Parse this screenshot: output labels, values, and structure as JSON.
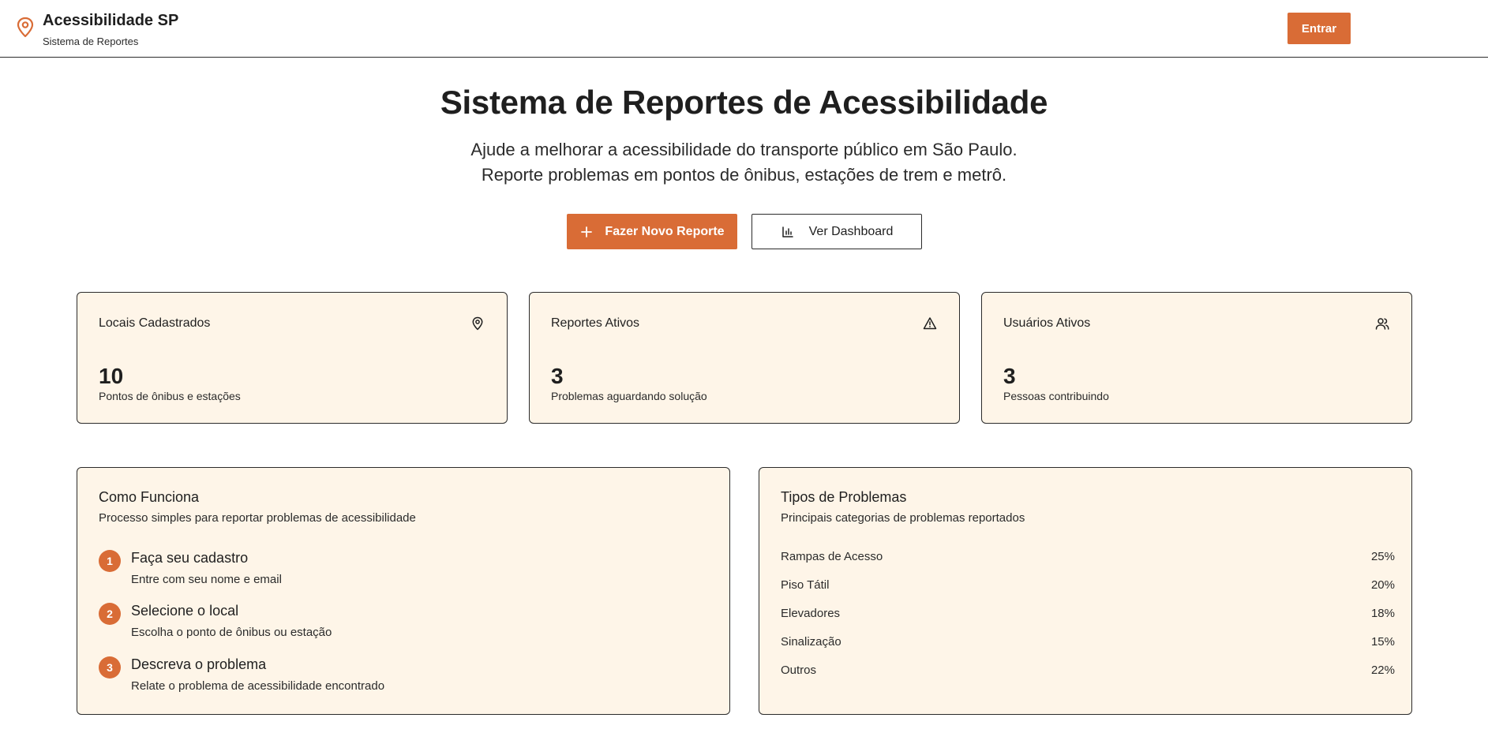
{
  "header": {
    "brand_title": "Acessibilidade SP",
    "brand_subtitle": "Sistema de Reportes",
    "brand_icon": "map-pin-icon",
    "login_label": "Entrar"
  },
  "hero": {
    "title": "Sistema de Reportes de Acessibilidade",
    "subtitle_line1": "Ajude a melhorar a acessibilidade do transporte público em São Paulo.",
    "subtitle_line2": "Reporte problemas em pontos de ônibus, estações de trem e metrô.",
    "primary_button": "Fazer Novo Reporte",
    "secondary_button": "Ver Dashboard"
  },
  "stats": [
    {
      "title": "Locais Cadastrados",
      "value": "10",
      "description": "Pontos de ônibus e estações",
      "icon": "map-pin-icon"
    },
    {
      "title": "Reportes Ativos",
      "value": "3",
      "description": "Problemas aguardando solução",
      "icon": "alert-triangle-icon"
    },
    {
      "title": "Usuários Ativos",
      "value": "3",
      "description": "Pessoas contribuindo",
      "icon": "users-icon"
    }
  ],
  "how_it_works": {
    "title": "Como Funciona",
    "subtitle": "Processo simples para reportar problemas de acessibilidade",
    "steps": [
      {
        "number": "1",
        "title": "Faça seu cadastro",
        "description": "Entre com seu nome e email"
      },
      {
        "number": "2",
        "title": "Selecione o local",
        "description": "Escolha o ponto de ônibus ou estação"
      },
      {
        "number": "3",
        "title": "Descreva o problema",
        "description": "Relate o problema de acessibilidade encontrado"
      }
    ]
  },
  "problem_types": {
    "title": "Tipos de Problemas",
    "subtitle": "Principais categorias de problemas reportados",
    "items": [
      {
        "label": "Rampas de Acesso",
        "percent": "25%"
      },
      {
        "label": "Piso Tátil",
        "percent": "20%"
      },
      {
        "label": "Elevadores",
        "percent": "18%"
      },
      {
        "label": "Sinalização",
        "percent": "15%"
      },
      {
        "label": "Outros",
        "percent": "22%"
      }
    ]
  },
  "colors": {
    "accent": "#d96c36",
    "card_background": "#fef5e8",
    "border": "#2b2b2b"
  }
}
